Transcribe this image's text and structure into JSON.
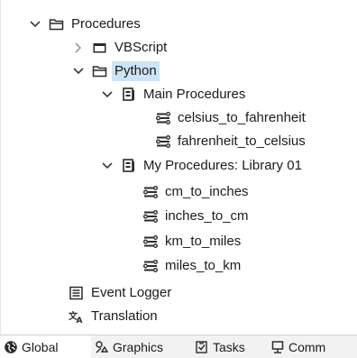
{
  "tree": {
    "procedures": "Procedures",
    "vbscript": "VBScript",
    "python": "Python",
    "main_procedures": "Main Procedures",
    "celsius_to_fahrenheit": "celsius_to_fahrenheit",
    "fahrenheit_to_celsius": "fahrenheit_to_celsius",
    "my_procedures": "My Procedures: Library 01",
    "cm_to_inches": "cm_to_inches",
    "inches_to_cm": "inches_to_cm",
    "km_to_miles": "km_to_miles",
    "miles_to_km": "miles_to_km",
    "event_logger": "Event Logger",
    "translation": "Translation"
  },
  "tabs": {
    "global": "Global",
    "graphics": "Graphics",
    "tasks": "Tasks",
    "comm": "Comm"
  },
  "colors": {
    "selection": "#cce4f7",
    "icon": "#3a3a3a"
  },
  "icons": {
    "expand": "chevron-down-icon",
    "collapse": "chevron-right-icon",
    "folder": "folder-icon",
    "folder_open": "folder-open-icon",
    "library": "library-icon",
    "procedure": "procedure-icon",
    "logger": "event-logger-icon",
    "translate": "translation-icon",
    "globe": "globe-icon",
    "graphics": "graphics-icon",
    "tasks": "tasks-icon",
    "comm": "comm-icon"
  }
}
